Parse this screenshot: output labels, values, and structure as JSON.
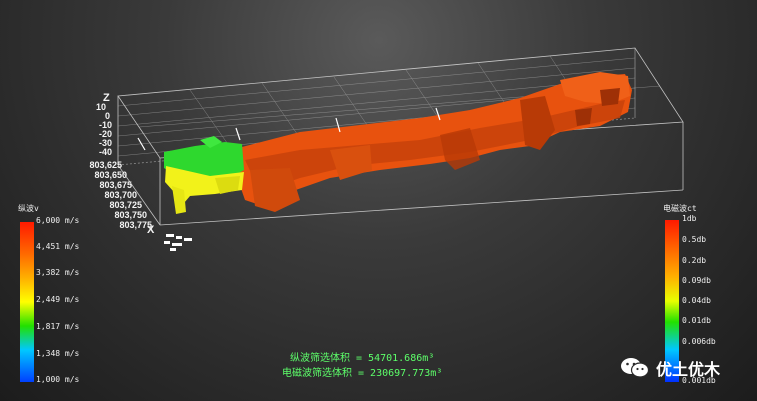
{
  "axes": {
    "z_label": "Z",
    "x_label": "X",
    "z_ticks": [
      "10",
      "0",
      "-10",
      "-20",
      "-30",
      "-40"
    ],
    "x_ticks": [
      "803,625",
      "803,650",
      "803,675",
      "803,700",
      "803,725",
      "803,750",
      "803,775"
    ]
  },
  "left_legend": {
    "title": "纵波v",
    "ticks": [
      "6,000 m/s",
      "4,451 m/s",
      "3,382 m/s",
      "2,449 m/s",
      "1,817 m/s",
      "1,348 m/s",
      "1,000 m/s"
    ],
    "colors": [
      "#ff1a00",
      "#ff6a00",
      "#ffb000",
      "#ffff00",
      "#22e000",
      "#00c8ff",
      "#0040ff"
    ]
  },
  "right_legend": {
    "title": "电磁波ct",
    "ticks": [
      "1db",
      "0.5db",
      "0.2db",
      "0.09db",
      "0.04db",
      "0.01db",
      "0.006db",
      "0.001db"
    ]
  },
  "volumes": {
    "p_wave": "纵波筛选体积 = 54701.686m³",
    "em_wave": "电磁波筛选体积 = 230697.773m³"
  },
  "watermark": {
    "text": "优土优木",
    "icon": "wechat-icon"
  },
  "colors": {
    "orange_body": "#e8520e",
    "orange_dark": "#b83a06",
    "green_body": "#2ed82e",
    "yellow_body": "#f2f21a",
    "volume_text": "#5dff6a"
  }
}
